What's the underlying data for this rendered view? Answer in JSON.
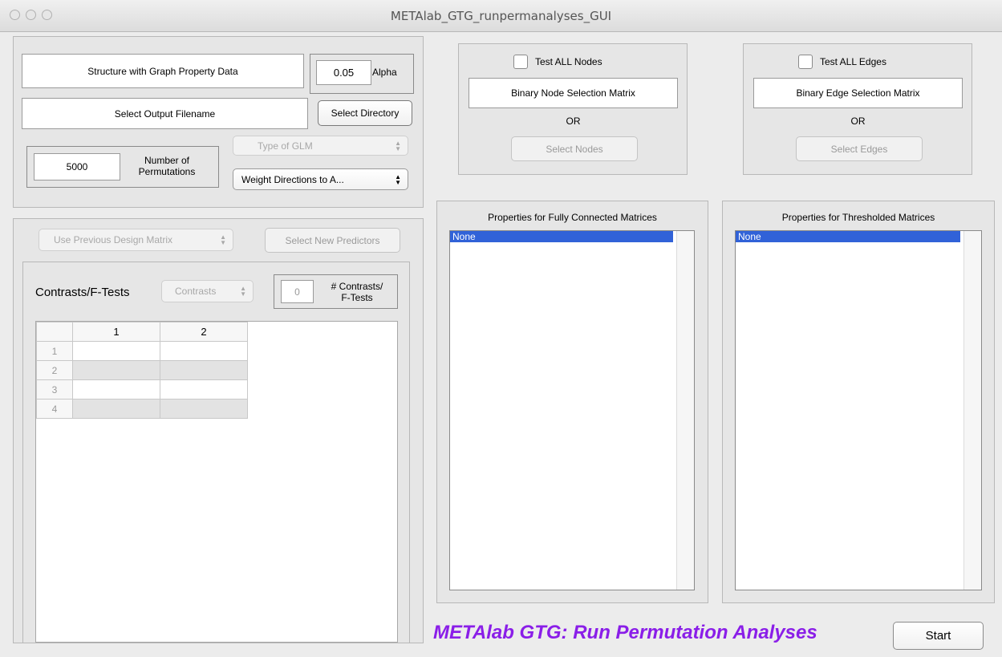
{
  "window": {
    "title": "METAlab_GTG_runpermanalyses_GUI"
  },
  "inputs": {
    "structure_label": "Structure with Graph Property Data",
    "alpha_value": "0.05",
    "alpha_label": "Alpha",
    "output_filename_label": "Select Output Filename",
    "select_directory": "Select Directory",
    "permutations_value": "5000",
    "permutations_label_1": "Number of",
    "permutations_label_2": "Permutations",
    "glm_type": "Type of GLM",
    "weight_directions": "Weight Directions to A..."
  },
  "design": {
    "design_matrix": "Use Previous Design Matrix",
    "select_predictors": "Select New Predictors",
    "contrasts_label": "Contrasts/F-Tests",
    "contrasts_popup": "Contrasts",
    "num_contrasts_value": "0",
    "num_contrasts_label_1": "# Contrasts/",
    "num_contrasts_label_2": "F-Tests",
    "table": {
      "columns": [
        "1",
        "2"
      ],
      "rows": [
        "1",
        "2",
        "3",
        "4"
      ]
    }
  },
  "nodes": {
    "test_all": "Test ALL Nodes",
    "matrix_label": "Binary Node Selection Matrix",
    "or": "OR",
    "select": "Select Nodes"
  },
  "edges": {
    "test_all": "Test ALL Edges",
    "matrix_label": "Binary Edge Selection Matrix",
    "or": "OR",
    "select": "Select Edges"
  },
  "properties": {
    "fully_connected_title": "Properties for Fully Connected Matrices",
    "fully_connected_items": [
      "None"
    ],
    "thresholded_title": "Properties for Thresholded Matrices",
    "thresholded_items": [
      "None"
    ]
  },
  "footer": {
    "banner": "METAlab GTG: Run Permutation Analyses",
    "banner_color": "#8a1ee8",
    "start": "Start"
  }
}
